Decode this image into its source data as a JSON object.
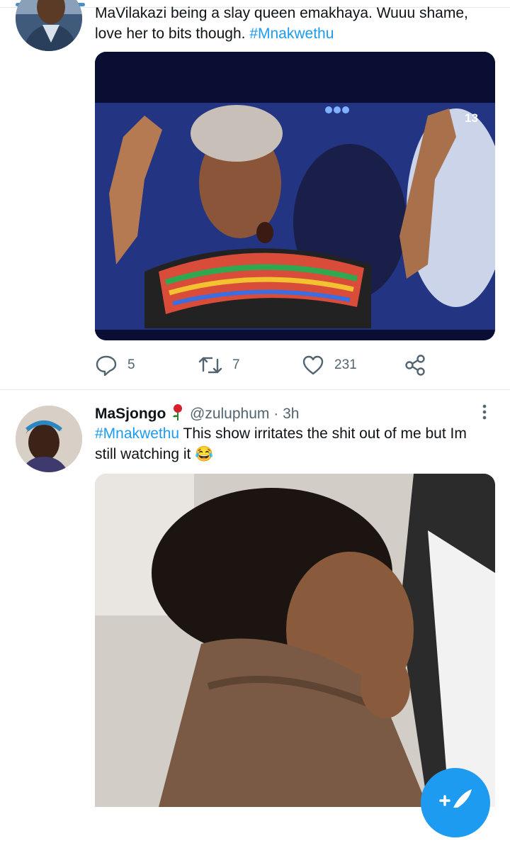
{
  "tweet1": {
    "text": "MaVilakazi being a slay queen emakhaya. Wuuu shame, love her to bits though. ",
    "hashtag": "#Mnakwethu",
    "media": {
      "overlay_badge": "13"
    },
    "actions": {
      "reply_count": "5",
      "retweet_count": "7",
      "like_count": "231"
    }
  },
  "tweet2": {
    "display_name": "MaSjongo",
    "handle": "@zuluphum",
    "separator": " · ",
    "time": "3h",
    "hashtag": "#Mnakwethu",
    "text": " This show irritates the shit out of me but Im still watching it 😂"
  },
  "colors": {
    "accent": "#1d9bf0",
    "muted": "#536471",
    "text": "#0f1419"
  },
  "icons": [
    "reply-icon",
    "retweet-icon",
    "like-icon",
    "share-icon",
    "more-icon",
    "compose-icon",
    "rose-emoji-icon"
  ]
}
